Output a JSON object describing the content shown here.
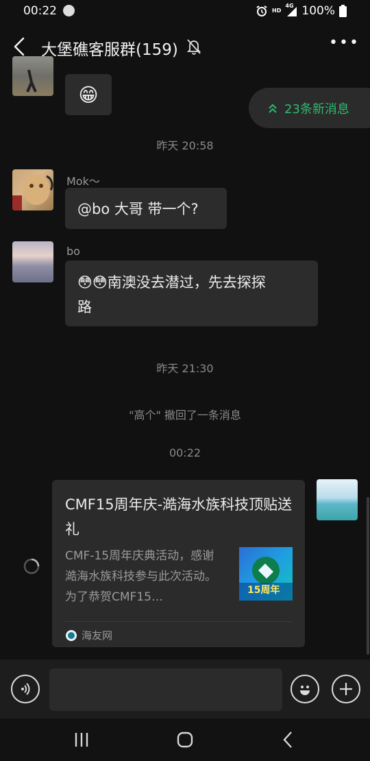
{
  "status_bar": {
    "time": "00:22",
    "network_label": "HD",
    "signal_label": "4G",
    "battery": "100%"
  },
  "header": {
    "title": "大堡礁客服群(159)",
    "more_label": "•••"
  },
  "new_messages": {
    "label": "23条新消息"
  },
  "messages": [
    {
      "type": "emoji",
      "emoji": "😁"
    },
    {
      "type": "time",
      "text": "昨天 20:58"
    },
    {
      "type": "text",
      "sender": "Mok～",
      "text": "@bo  大哥 带一个?"
    },
    {
      "type": "text",
      "sender": "bo",
      "text_line1": "😳😳南澳没去潜过，先去探探",
      "text_line2": "路"
    },
    {
      "type": "time",
      "text": "昨天 21:30"
    },
    {
      "type": "system",
      "text": "\"高个\" 撤回了一条消息"
    },
    {
      "type": "time",
      "text": "00:22"
    },
    {
      "type": "link",
      "title": "CMF15周年庆-澔海水族科技顶贴送礼",
      "description": "CMF-15周年庆典活动，感谢澔海水族科技参与此次活动。为了恭贺CMF15…",
      "thumb_text": "15周年",
      "source": "海友网"
    }
  ],
  "colors": {
    "background": "#111111",
    "bubble": "#2c2c2c",
    "accent_green": "#2dba6e"
  },
  "icons": [
    "back-icon",
    "mute-bell-icon",
    "more-icon",
    "double-chevron-up-icon",
    "voice-icon",
    "emoji-icon",
    "plus-icon",
    "recent-apps-icon",
    "home-icon",
    "nav-back-icon",
    "loading-spinner-icon"
  ]
}
